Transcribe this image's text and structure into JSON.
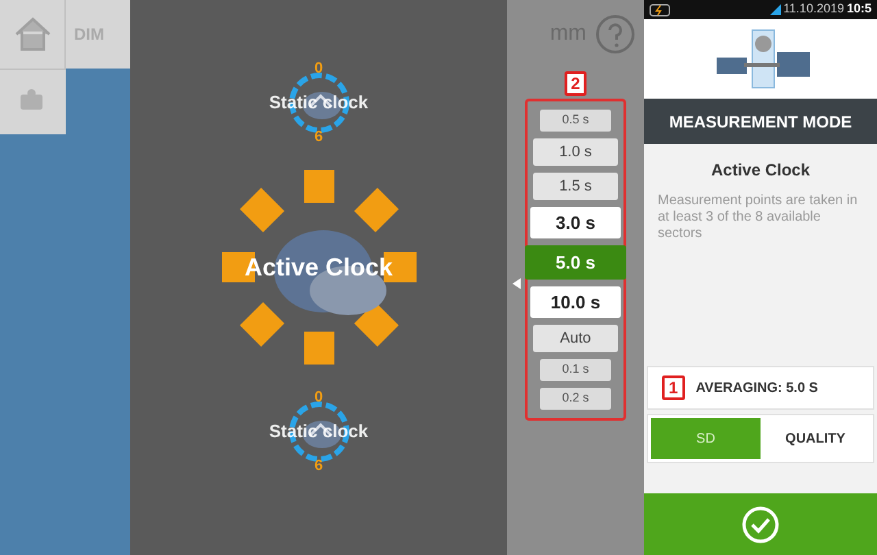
{
  "toolbar": {
    "dimension_label": "DIM",
    "unit": "mm"
  },
  "modes": [
    {
      "kind": "static",
      "label": "Static clock",
      "dial_digits": [
        "0",
        "6"
      ],
      "selected": false
    },
    {
      "kind": "active",
      "label": "Active Clock",
      "selected": true
    },
    {
      "kind": "static",
      "label": "Static clock",
      "dial_digits": [
        "0",
        "6"
      ],
      "selected": false
    }
  ],
  "averaging_callout": "2",
  "averaging_options": [
    {
      "label": "0.5 s",
      "kind": "small",
      "selected": false
    },
    {
      "label": "1.0 s",
      "kind": "regular",
      "selected": false
    },
    {
      "label": "1.5 s",
      "kind": "regular",
      "selected": false
    },
    {
      "label": "3.0 s",
      "kind": "emphasized",
      "selected": false
    },
    {
      "label": "5.0 s",
      "kind": "emphasized",
      "selected": true
    },
    {
      "label": "10.0 s",
      "kind": "emphasized",
      "selected": false
    },
    {
      "label": "Auto",
      "kind": "regular",
      "selected": false
    },
    {
      "label": "0.1 s",
      "kind": "small",
      "selected": false
    },
    {
      "label": "0.2 s",
      "kind": "small",
      "selected": false
    }
  ],
  "status_bar": {
    "date": "11.10.2019",
    "time": "10:5"
  },
  "panel": {
    "header": "MEASUREMENT MODE",
    "mode_title": "Active Clock",
    "description": "Measurement points are taken in at least 3 of the 8 available sectors",
    "averaging_callout": "1",
    "averaging": "AVERAGING: 5.0 S",
    "evaluation_tabs": [
      {
        "label": "SD",
        "selected": true
      },
      {
        "label": "QUALITY",
        "selected": false
      }
    ]
  }
}
